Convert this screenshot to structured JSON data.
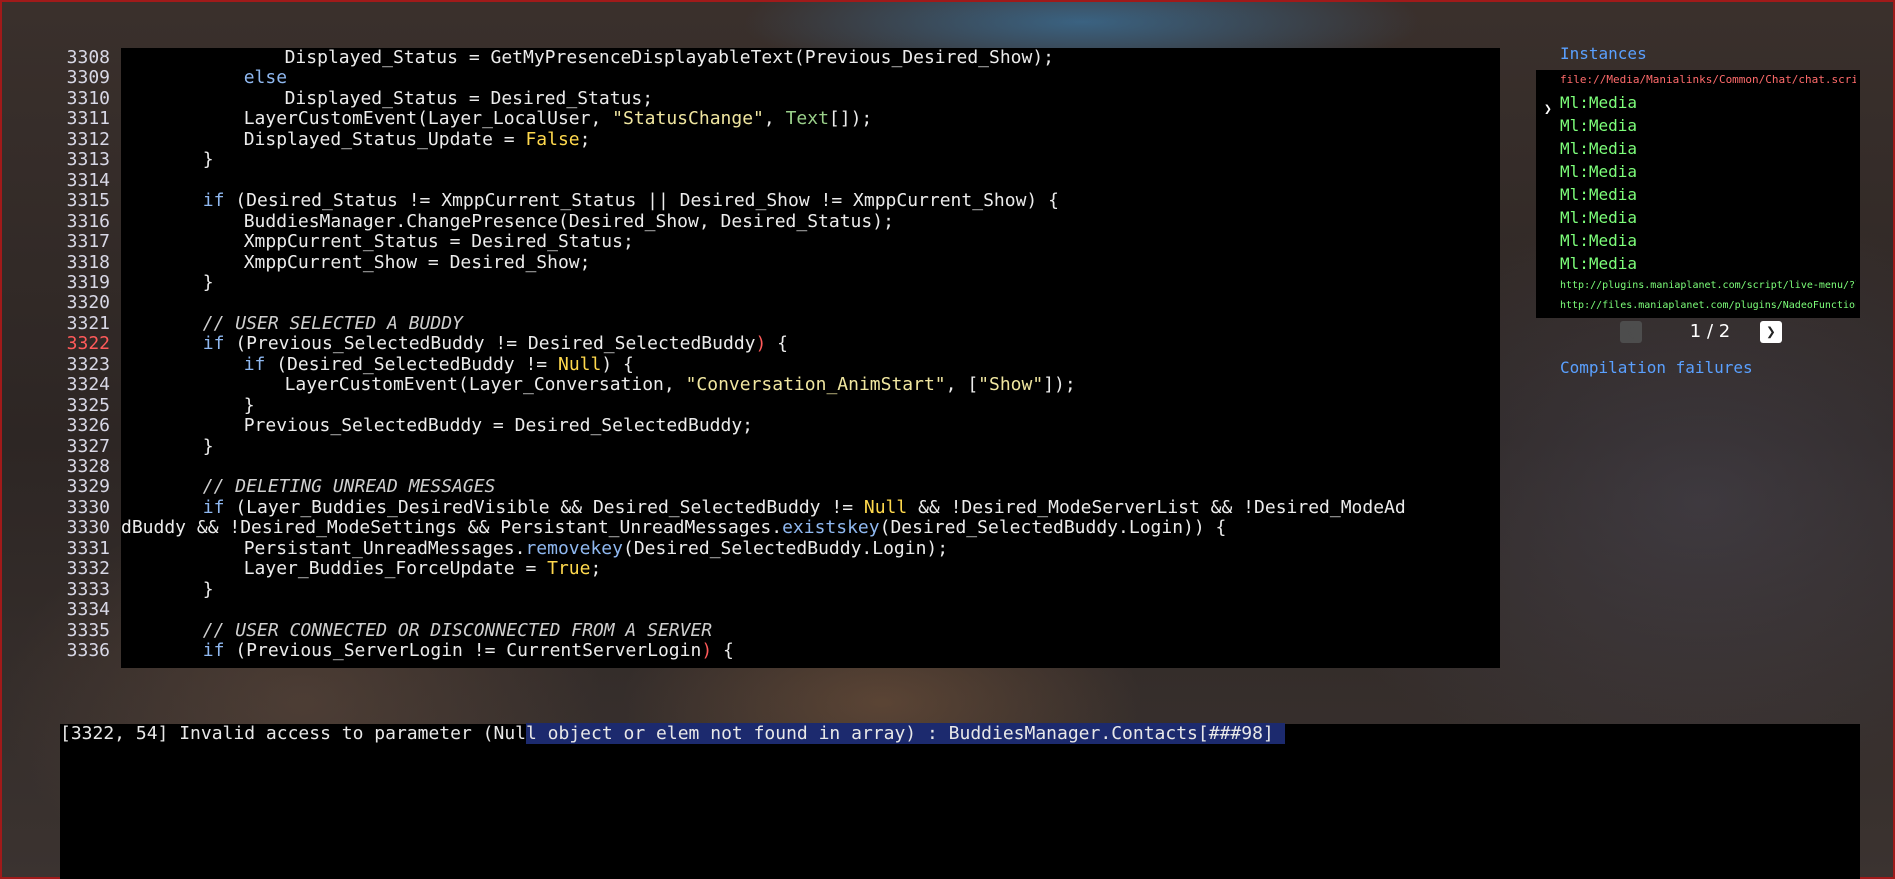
{
  "editor": {
    "lines": [
      {
        "n": "3308",
        "indent": 4,
        "tokens": [
          [
            "t",
            "Displayed_Status = GetMyPresenceDisplayableText(Previous_Desired_Show);"
          ]
        ]
      },
      {
        "n": "3309",
        "indent": 3,
        "tokens": [
          [
            "kw",
            "else"
          ]
        ]
      },
      {
        "n": "3310",
        "indent": 4,
        "tokens": [
          [
            "t",
            "Displayed_Status = Desired_Status;"
          ]
        ]
      },
      {
        "n": "3311",
        "indent": 3,
        "tokens": [
          [
            "t",
            "LayerCustomEvent(Layer_LocalUser, "
          ],
          [
            "str",
            "\"StatusChange\""
          ],
          [
            "t",
            ", "
          ],
          [
            "fn",
            "Text"
          ],
          [
            "t",
            "[]);"
          ]
        ]
      },
      {
        "n": "3312",
        "indent": 3,
        "tokens": [
          [
            "t",
            "Displayed_Status_Update = "
          ],
          [
            "lit",
            "False"
          ],
          [
            "t",
            ";"
          ]
        ]
      },
      {
        "n": "3313",
        "indent": 2,
        "tokens": [
          [
            "t",
            "}"
          ]
        ]
      },
      {
        "n": "3314",
        "indent": 0,
        "tokens": []
      },
      {
        "n": "3315",
        "indent": 2,
        "tokens": [
          [
            "kw",
            "if"
          ],
          [
            "t",
            " (Desired_Status != XmppCurrent_Status || Desired_Show != XmppCurrent_Show) {"
          ]
        ]
      },
      {
        "n": "3316",
        "indent": 3,
        "tokens": [
          [
            "t",
            "BuddiesManager.ChangePresence(Desired_Show, Desired_Status);"
          ]
        ]
      },
      {
        "n": "3317",
        "indent": 3,
        "tokens": [
          [
            "t",
            "XmppCurrent_Status = Desired_Status;"
          ]
        ]
      },
      {
        "n": "3318",
        "indent": 3,
        "tokens": [
          [
            "t",
            "XmppCurrent_Show = Desired_Show;"
          ]
        ]
      },
      {
        "n": "3319",
        "indent": 2,
        "tokens": [
          [
            "t",
            "}"
          ]
        ]
      },
      {
        "n": "3320",
        "indent": 0,
        "tokens": []
      },
      {
        "n": "3321",
        "indent": 2,
        "tokens": [
          [
            "cm",
            "// USER SELECTED A BUDDY"
          ]
        ]
      },
      {
        "n": "3322",
        "indent": 2,
        "error": true,
        "tokens": [
          [
            "kw",
            "if"
          ],
          [
            "t",
            " (Previous_SelectedBuddy != Desired_SelectedBuddy"
          ],
          [
            "brk",
            ")"
          ],
          [
            "t",
            " {"
          ]
        ]
      },
      {
        "n": "3323",
        "indent": 3,
        "tokens": [
          [
            "kw",
            "if"
          ],
          [
            "t",
            " (Desired_SelectedBuddy != "
          ],
          [
            "lit",
            "Null"
          ],
          [
            "t",
            ") {"
          ]
        ]
      },
      {
        "n": "3324",
        "indent": 4,
        "tokens": [
          [
            "t",
            "LayerCustomEvent(Layer_Conversation, "
          ],
          [
            "str",
            "\"Conversation_AnimStart\""
          ],
          [
            "t",
            ", ["
          ],
          [
            "str",
            "\"Show\""
          ],
          [
            "t",
            "]);"
          ]
        ]
      },
      {
        "n": "3325",
        "indent": 3,
        "tokens": [
          [
            "t",
            "}"
          ]
        ]
      },
      {
        "n": "3326",
        "indent": 3,
        "tokens": [
          [
            "t",
            "Previous_SelectedBuddy = Desired_SelectedBuddy;"
          ]
        ]
      },
      {
        "n": "3327",
        "indent": 2,
        "tokens": [
          [
            "t",
            "}"
          ]
        ]
      },
      {
        "n": "3328",
        "indent": 0,
        "tokens": []
      },
      {
        "n": "3329",
        "indent": 2,
        "tokens": [
          [
            "cm",
            "// DELETING UNREAD MESSAGES"
          ]
        ]
      },
      {
        "n": "3330",
        "indent": 2,
        "tokens": [
          [
            "kw",
            "if"
          ],
          [
            "t",
            " (Layer_Buddies_DesiredVisible && Desired_SelectedBuddy != "
          ],
          [
            "lit",
            "Null"
          ],
          [
            "t",
            " && !Desired_ModeServerList && !Desired_ModeAd"
          ]
        ]
      },
      {
        "n": "3330",
        "indent": 0,
        "tokens": [
          [
            "t",
            "dBuddy && !Desired_ModeSettings && Persistant_UnreadMessages."
          ],
          [
            "kw",
            "existskey"
          ],
          [
            "t",
            "(Desired_SelectedBuddy.Login)) {"
          ]
        ]
      },
      {
        "n": "3331",
        "indent": 3,
        "tokens": [
          [
            "t",
            "Persistant_UnreadMessages."
          ],
          [
            "kw",
            "removekey"
          ],
          [
            "t",
            "(Desired_SelectedBuddy.Login);"
          ]
        ]
      },
      {
        "n": "3332",
        "indent": 3,
        "tokens": [
          [
            "t",
            "Layer_Buddies_ForceUpdate = "
          ],
          [
            "lit",
            "True"
          ],
          [
            "t",
            ";"
          ]
        ]
      },
      {
        "n": "3333",
        "indent": 2,
        "tokens": [
          [
            "t",
            "}"
          ]
        ]
      },
      {
        "n": "3334",
        "indent": 0,
        "tokens": []
      },
      {
        "n": "3335",
        "indent": 2,
        "tokens": [
          [
            "cm",
            "// USER CONNECTED OR DISCONNECTED FROM A SERVER"
          ]
        ]
      },
      {
        "n": "3336",
        "indent": 2,
        "tokens": [
          [
            "kw",
            "if"
          ],
          [
            "t",
            " (Previous_ServerLogin != CurrentServerLogin"
          ],
          [
            "brk",
            ")"
          ],
          [
            "t",
            " {"
          ]
        ]
      }
    ]
  },
  "side": {
    "instances_title": "Instances",
    "selected_marker": "❯",
    "selected_file": "file://Media/Manialinks/Common/Chat/chat.script.txt",
    "items": [
      "Ml:Media",
      "Ml:Media",
      "Ml:Media",
      "Ml:Media",
      "Ml:Media",
      "Ml:Media",
      "Ml:Media",
      "Ml:Media"
    ],
    "links": [
      "http://plugins.maniaplanet.com/script/live-menu/?login=dreamny",
      "http://files.maniaplanet.com/plugins/NadeoFunctions.Script.txt"
    ],
    "pager": {
      "prev": "❮",
      "text": "1 / 2",
      "next": "❯"
    },
    "failures_title": "Compilation failures"
  },
  "console": {
    "prefix": "[3322, 54] Invalid access to parameter (Nul",
    "highlighted": "l object or elem not found in array) : BuddiesManager.Contacts[###98] "
  }
}
